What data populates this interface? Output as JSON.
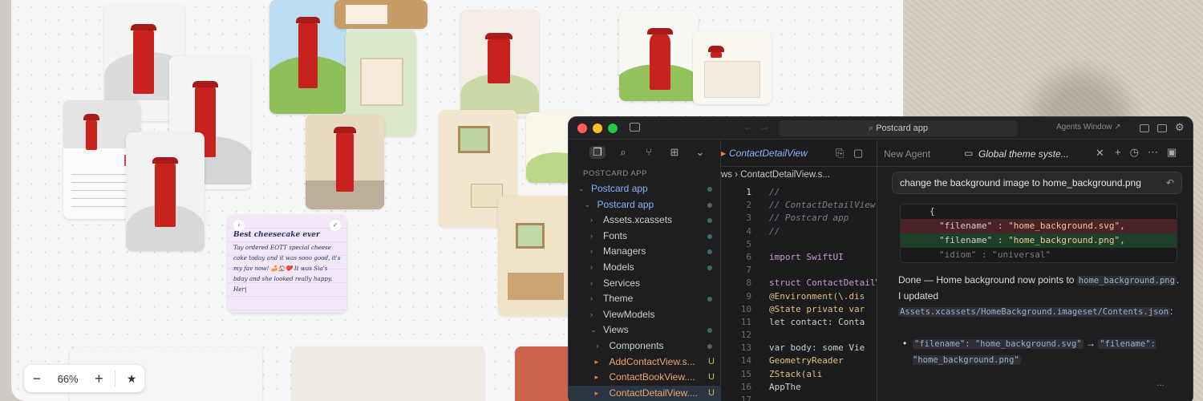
{
  "zoom": {
    "minus": "−",
    "level": "66%",
    "plus": "+",
    "fit_icon": "★"
  },
  "note": {
    "back": "‹",
    "check": "✓",
    "title": "Best cheesecake ever",
    "body": "Tay ordered EOTT special cheese cake today and it was sooo good, it's my fav now! 🍰🏠❤️ It was Sia's bday and she looked really happy. Her|"
  },
  "window": {
    "search": "Postcard app",
    "agents_window": "Agents Window ↗",
    "colors": {
      "close": "#ff5f57",
      "minimize": "#febc2e",
      "maximize": "#28c840"
    }
  },
  "sidebar": {
    "section": "POSTCARD APP",
    "tools": [
      "files-icon",
      "search-icon",
      "branch-icon",
      "extensions-icon",
      "chevron-down-icon"
    ],
    "items": [
      {
        "label": "Postcard app",
        "chev": "⌄",
        "indent": 1,
        "style": "blue",
        "mark": "dot"
      },
      {
        "label": "Postcard app",
        "chev": "⌄",
        "indent": 2,
        "style": "blue",
        "mark": "dot"
      },
      {
        "label": "Assets.xcassets",
        "chev": "›",
        "indent": 3,
        "style": "",
        "mark": "dot"
      },
      {
        "label": "Fonts",
        "chev": "›",
        "indent": 3,
        "style": "",
        "mark": "dot"
      },
      {
        "label": "Managers",
        "chev": "›",
        "indent": 3,
        "style": "",
        "mark": "dot"
      },
      {
        "label": "Models",
        "chev": "›",
        "indent": 3,
        "style": "",
        "mark": "dot"
      },
      {
        "label": "Services",
        "chev": "›",
        "indent": 3,
        "style": "",
        "mark": ""
      },
      {
        "label": "Theme",
        "chev": "›",
        "indent": 3,
        "style": "",
        "mark": "dot"
      },
      {
        "label": "ViewModels",
        "chev": "›",
        "indent": 3,
        "style": "",
        "mark": ""
      },
      {
        "label": "Views",
        "chev": "⌄",
        "indent": 3,
        "style": "",
        "mark": "dot"
      },
      {
        "label": "Components",
        "chev": "›",
        "indent": 4,
        "style": "",
        "mark": "dot"
      },
      {
        "label": "AddContactView.s...",
        "chev": "",
        "indent": 4,
        "style": "orange",
        "mark": "U"
      },
      {
        "label": "ContactBookView....",
        "chev": "",
        "indent": 4,
        "style": "orange",
        "mark": "U"
      },
      {
        "label": "ContactDetailView....",
        "chev": "",
        "indent": 4,
        "style": "orange sel",
        "mark": "U"
      }
    ]
  },
  "editor": {
    "tab": "ContactDetailView",
    "breadcrumb": "ws ›  ContactDetailView.s...",
    "lines": [
      {
        "n": "1",
        "text": "//",
        "cls": "cm"
      },
      {
        "n": "2",
        "text": "//  ContactDetailView",
        "cls": "cm"
      },
      {
        "n": "3",
        "text": "//  Postcard app",
        "cls": "cm"
      },
      {
        "n": "4",
        "text": "//",
        "cls": "cm"
      },
      {
        "n": "5",
        "text": "",
        "cls": "pl"
      },
      {
        "n": "6",
        "text": "import SwiftUI",
        "cls": "kw"
      },
      {
        "n": "7",
        "text": "",
        "cls": "pl"
      },
      {
        "n": "8",
        "text": "struct ContactDetailVi",
        "cls": "kw"
      },
      {
        "n": "9",
        "text": "    @Environment(\\.dis",
        "cls": "ty"
      },
      {
        "n": "10",
        "text": "    @State private var",
        "cls": "ty"
      },
      {
        "n": "11",
        "text": "    let contact: Conta",
        "cls": "pl"
      },
      {
        "n": "12",
        "text": "",
        "cls": "pl"
      },
      {
        "n": "13",
        "text": "    var body: some Vie",
        "cls": "pl"
      },
      {
        "n": "14",
        "text": "        GeometryReader",
        "cls": "ty"
      },
      {
        "n": "15",
        "text": "            ZStack(ali",
        "cls": "ty"
      },
      {
        "n": "16",
        "text": "                AppThe",
        "cls": "pl"
      },
      {
        "n": "17",
        "text": "",
        "cls": "pl"
      }
    ]
  },
  "agent": {
    "new_agent": "New Agent",
    "active_tab": "Global theme syste...",
    "close": "✕",
    "prompt": "change the background image to home_background.png",
    "diff": {
      "brace": "{",
      "removed": [
        "\"filename\" : ",
        "\"home_background.svg\"",
        ","
      ],
      "added": [
        "\"filename\" : ",
        "\"home_background.png\"",
        ","
      ],
      "context": "\"idiom\" : \"universal\""
    },
    "done_prefix": "Done — Home background now points to ",
    "done_code": "home_background.png",
    "done_suffix": ".",
    "updated_prefix": "I updated ",
    "updated_code": "Assets.xcassets/HomeBackground.imageset/Contents.json",
    "updated_suffix": ":",
    "bullet_from": "\"filename\": \"home_background.svg\"",
    "bullet_arrow": " → ",
    "bullet_to": "\"filename\": \"home_background.png\"",
    "more": "..."
  }
}
